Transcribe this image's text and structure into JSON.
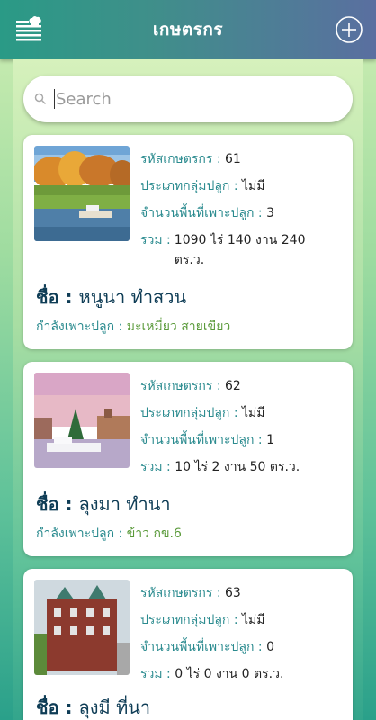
{
  "header": {
    "title": "เกษตรกร",
    "menu_icon": "menu-chef-icon",
    "add_icon": "plus-circle-icon"
  },
  "search": {
    "placeholder": "Search",
    "icon": "search-icon"
  },
  "labels": {
    "code": "รหัสเกษตรกร : ",
    "group": "ประเภทกลุ่มปลูก : ",
    "area": "จำนวนพื้นที่เพาะปลูก : ",
    "total": "รวม : ",
    "name": "ชื่อ : ",
    "growing": "กำลังเพาะปลูก : "
  },
  "farmers": [
    {
      "code": "61",
      "group": "ไม่มี",
      "area": "3",
      "total": "1090 ไร่ 140 งาน 240 ตร.ว.",
      "name": "หนูนา ทำสวน",
      "growing": "มะเหมี่ยว สายเขียว",
      "image": "autumn-lakeside-photo"
    },
    {
      "code": "62",
      "group": "ไม่มี",
      "area": "1",
      "total": "10 ไร่ 2 งาน 50 ตร.ว.",
      "name": "ลุงมา ทำนา",
      "growing": "ข้าว กข.6",
      "image": "harbor-christmas-photo"
    },
    {
      "code": "63",
      "group": "ไม่มี",
      "area": "0",
      "total": "0 ไร่ 0 งาน 0 ตร.ว.",
      "name": "ลุงมี ที่นา",
      "growing": "",
      "image": "brick-building-photo"
    }
  ],
  "colors": {
    "header_start": "#2a9a86",
    "header_end": "#5a6fa0",
    "label": "#2b8b8f",
    "name": "#0f3d56",
    "crop": "#5a9a3a"
  }
}
